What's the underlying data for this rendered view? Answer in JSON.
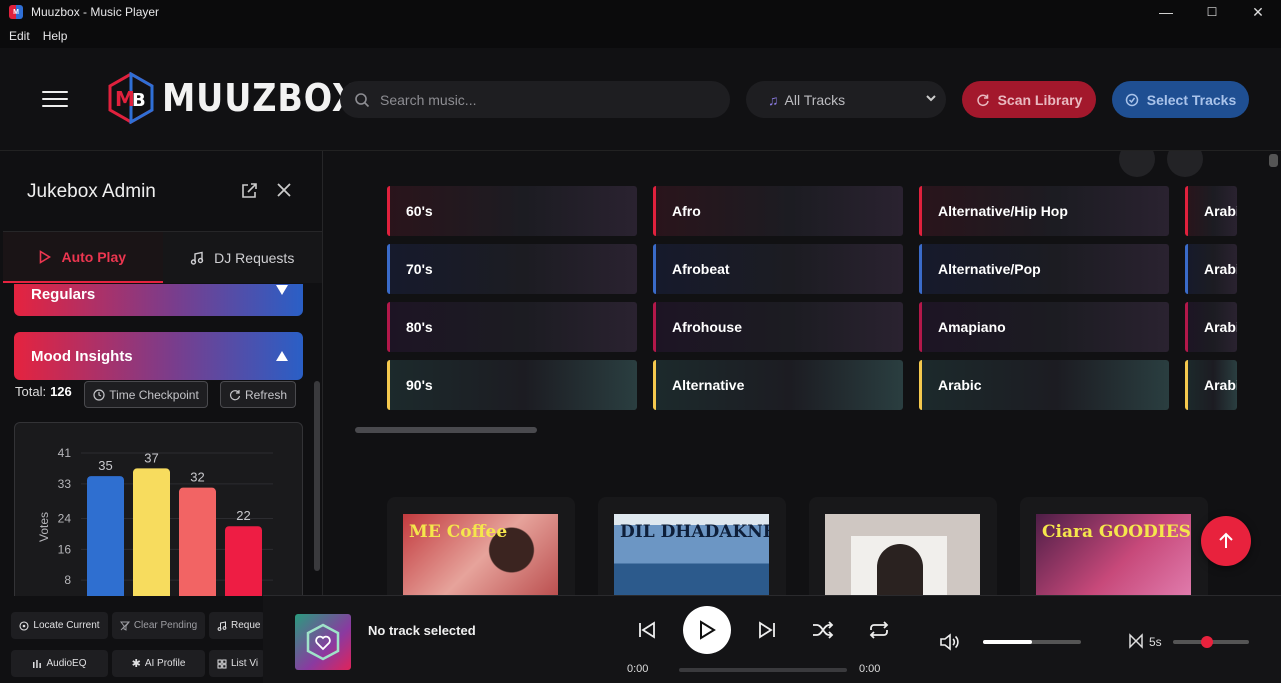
{
  "window": {
    "title": "Muuzbox - Music Player",
    "minimize": "—",
    "maximize": "☐",
    "close": "✕"
  },
  "menu": [
    "Edit",
    "Help"
  ],
  "header": {
    "logo_text": "MUUZBOX",
    "search_placeholder": "Search music...",
    "track_filter": "All Tracks",
    "scan_label": "Scan Library",
    "select_label": "Select Tracks",
    "scan_color": "#a3182c",
    "select_color": "#1f4f92"
  },
  "panel": {
    "title": "Jukebox Admin",
    "tabs": [
      {
        "label": "Auto Play",
        "active": true
      },
      {
        "label": "DJ Requests",
        "active": false
      }
    ],
    "accordions": [
      {
        "label": "Regulars",
        "expanded": false
      },
      {
        "label": "Mood Insights",
        "expanded": true
      }
    ],
    "total_label": "Total:",
    "total_value": "126",
    "time_checkpoint": "Time Checkpoint",
    "refresh": "Refresh",
    "bottom_buttons": [
      {
        "label": "Locate Current",
        "icon": "locate-icon"
      },
      {
        "label": "Clear Pending",
        "icon": "clear-filter-icon"
      },
      {
        "label": "Reque",
        "icon": "music-note-icon"
      },
      {
        "label": "AudioEQ",
        "icon": "equalizer-icon"
      },
      {
        "label": "AI Profile",
        "icon": "sparkle-icon"
      },
      {
        "label": "List Vi",
        "icon": "grid-icon"
      }
    ]
  },
  "chart_data": {
    "type": "bar",
    "ylabel": "Votes",
    "yticks": [
      8,
      16,
      24,
      33,
      41
    ],
    "ylim": [
      0,
      41
    ],
    "grid": true,
    "values": [
      35,
      37,
      32,
      22
    ],
    "colors": [
      "#2f6fd0",
      "#f7dc5e",
      "#f26464",
      "#ee1d44"
    ]
  },
  "genres": {
    "columns": [
      [
        "60's",
        "70's",
        "80's",
        "90's"
      ],
      [
        "Afro",
        "Afrobeat",
        "Afrohouse",
        "Alternative"
      ],
      [
        "Alternative/Hip Hop",
        "Alternative/Pop",
        "Amapiano",
        "Arabic"
      ],
      [
        "Arabi",
        "Arabi",
        "Arabi",
        "Arabi"
      ]
    ],
    "row_accents": [
      "#e0213d",
      "#3a6bc9",
      "#b3184a",
      "#f5c94e"
    ]
  },
  "albums": [
    {
      "name": "album-art-me-coffee",
      "art_text": "ME Coffee"
    },
    {
      "name": "album-art-dil-dhadakne-do",
      "art_text": "DIL DHADAKNE DO"
    },
    {
      "name": "album-art-portrait",
      "art_text": ""
    },
    {
      "name": "album-art-ciara-goodies",
      "art_text": "Ciara GOODIES"
    }
  ],
  "player": {
    "now_playing": "No track selected",
    "time_elapsed": "0:00",
    "time_total": "0:00",
    "volume_level": 0.5,
    "crossfade_label": "5s",
    "crossfade_level": 0.45
  }
}
